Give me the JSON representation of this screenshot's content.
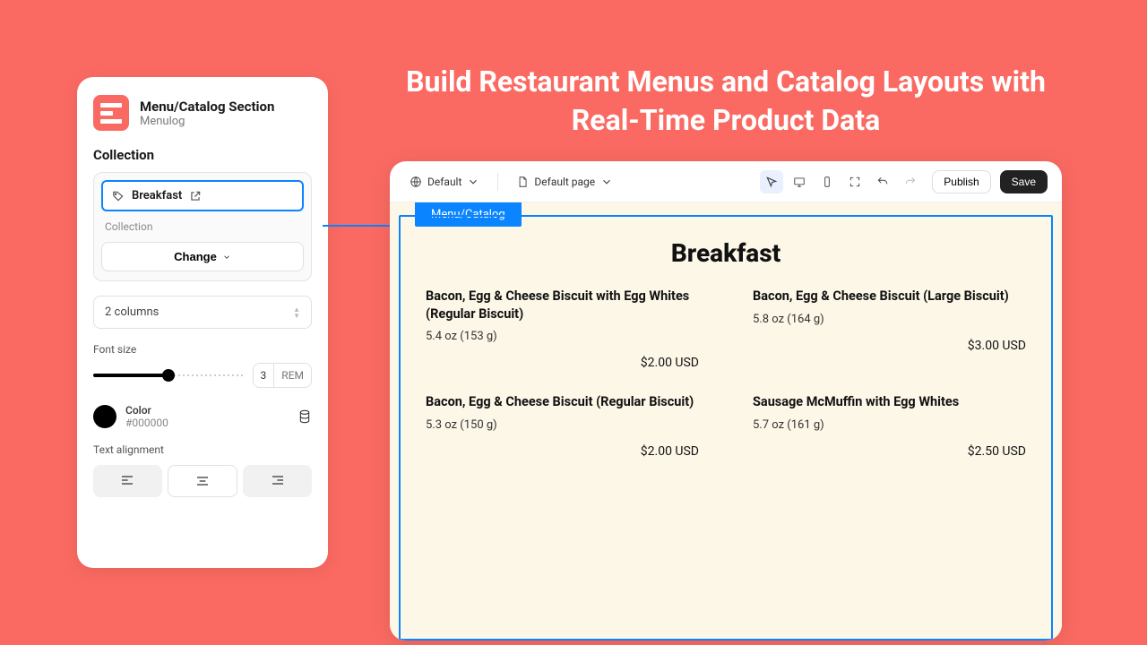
{
  "headline": "Build Restaurant Menus and Catalog Layouts with Real-Time Product Data",
  "panel": {
    "title": "Menu/Catalog Section",
    "subtitle": "Menulog",
    "section_label": "Collection",
    "chip_value": "Breakfast",
    "collection_inner_label": "Collection",
    "change_label": "Change",
    "columns_value": "2 columns",
    "font_size_label": "Font size",
    "font_size_value": "3",
    "font_size_unit": "REM",
    "color_label": "Color",
    "color_hex": "#000000",
    "alignment_label": "Text alignment"
  },
  "toolbar": {
    "theme_label": "Default",
    "page_label": "Default page",
    "publish": "Publish",
    "save": "Save"
  },
  "preview": {
    "tab_label": "Menu/Catalog",
    "menu_title": "Breakfast",
    "items": [
      {
        "name": "Bacon, Egg & Cheese Biscuit with Egg Whites (Regular Biscuit)",
        "weight": "5.4 oz (153 g)",
        "price": "$2.00 USD"
      },
      {
        "name": "Bacon, Egg & Cheese Biscuit (Large Biscuit)",
        "weight": "5.8 oz (164 g)",
        "price": "$3.00 USD"
      },
      {
        "name": "Bacon, Egg & Cheese Biscuit (Regular Biscuit)",
        "weight": "5.3 oz (150 g)",
        "price": "$2.00 USD"
      },
      {
        "name": "Sausage McMuffin with Egg Whites",
        "weight": "5.7 oz (161 g)",
        "price": "$2.50 USD"
      }
    ]
  }
}
